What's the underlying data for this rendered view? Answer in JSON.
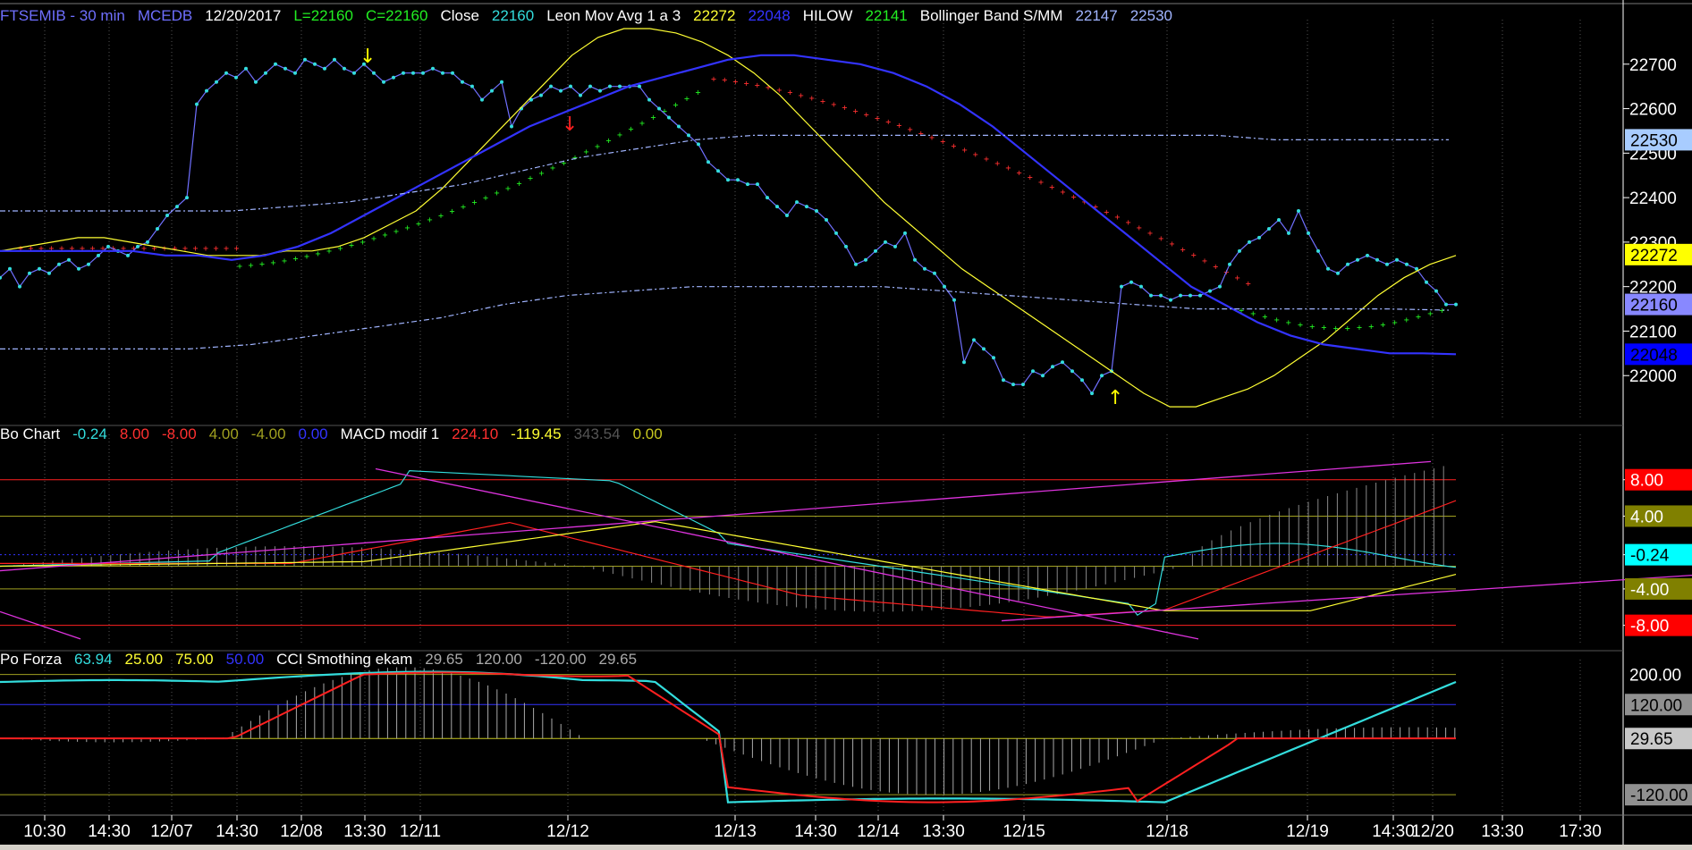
{
  "headers": {
    "price": [
      {
        "text": "FTSEMIB - 30 min",
        "color": "#6f6fff"
      },
      {
        "text": "MCEDB",
        "color": "#6f6fff"
      },
      {
        "text": "12/20/2017",
        "color": "#ffffff"
      },
      {
        "text": "L=22160",
        "color": "#22ee22"
      },
      {
        "text": "C=22160",
        "color": "#22ee22"
      },
      {
        "text": "Close",
        "color": "#ffffff"
      },
      {
        "text": "22160",
        "color": "#33dddd"
      },
      {
        "text": "Leon Mov Avg 1 a 3",
        "color": "#ffffff"
      },
      {
        "text": "22272",
        "color": "#ffff33"
      },
      {
        "text": "22048",
        "color": "#3333ff"
      },
      {
        "text": "HILOW",
        "color": "#ffffff"
      },
      {
        "text": "22141",
        "color": "#22ee22"
      },
      {
        "text": "Bollinger Band S/MM",
        "color": "#ffffff"
      },
      {
        "text": "22147",
        "color": "#a0b4ff"
      },
      {
        "text": "22530",
        "color": "#a0b4ff"
      }
    ],
    "macd": [
      {
        "text": "Bo Chart",
        "color": "#ffffff"
      },
      {
        "text": "-0.24",
        "color": "#33dddd"
      },
      {
        "text": "8.00",
        "color": "#ff3030"
      },
      {
        "text": "-8.00",
        "color": "#ff3030"
      },
      {
        "text": "4.00",
        "color": "#a0a020"
      },
      {
        "text": "-4.00",
        "color": "#a0a020"
      },
      {
        "text": "0.00",
        "color": "#3333ff"
      },
      {
        "text": "MACD modif 1",
        "color": "#ffffff"
      },
      {
        "text": "224.10",
        "color": "#ff3030"
      },
      {
        "text": "-119.45",
        "color": "#ffff33"
      },
      {
        "text": "343.54",
        "color": "#555555"
      },
      {
        "text": "0.00",
        "color": "#c8c820"
      }
    ],
    "cci": [
      {
        "text": "Po Forza",
        "color": "#ffffff"
      },
      {
        "text": "63.94",
        "color": "#33dddd"
      },
      {
        "text": "25.00",
        "color": "#ffff33"
      },
      {
        "text": "75.00",
        "color": "#ffff33"
      },
      {
        "text": "50.00",
        "color": "#3333ff"
      },
      {
        "text": "CCI Smothing ekam",
        "color": "#ffffff"
      },
      {
        "text": "29.65",
        "color": "#aaaaaa"
      },
      {
        "text": "120.00",
        "color": "#aaaaaa"
      },
      {
        "text": "-120.00",
        "color": "#aaaaaa"
      },
      {
        "text": "29.65",
        "color": "#aaaaaa"
      }
    ]
  },
  "chart_data": [
    {
      "type": "line",
      "title": "FTSEMIB - 30 min",
      "ylim": [
        21900,
        22800
      ],
      "y_ticks": [
        "22700",
        "22600",
        "22500",
        "22400",
        "22300",
        "22200",
        "22100",
        "22000"
      ],
      "tags": [
        {
          "label": "22530",
          "bg": "#a8ccff",
          "fg": "#000000"
        },
        {
          "label": "22272",
          "bg": "#ffff00",
          "fg": "#000000"
        },
        {
          "label": "22160",
          "bg": "#8888ff",
          "fg": "#000000"
        },
        {
          "label": "22048",
          "bg": "#0000ff",
          "fg": "#000000"
        }
      ],
      "series": [
        {
          "name": "Close",
          "color": "#33dddd",
          "values": [
            22220,
            22240,
            22200,
            22230,
            22240,
            22230,
            22250,
            22260,
            22240,
            22250,
            22270,
            22290,
            22280,
            22270,
            22290,
            22300,
            22330,
            22360,
            22380,
            22400,
            22610,
            22640,
            22660,
            22680,
            22670,
            22690,
            22660,
            22680,
            22700,
            22690,
            22680,
            22710,
            22700,
            22690,
            22710,
            22690,
            22680,
            22700,
            22680,
            22660,
            22670,
            22680,
            22680,
            22680,
            22690,
            22680,
            22680,
            22660,
            22650,
            22620,
            22640,
            22660,
            22560,
            22600,
            22620,
            22630,
            22650,
            22640,
            22650,
            22630,
            22650,
            22640,
            22650,
            22650,
            22650,
            22650,
            22620,
            22600,
            22580,
            22560,
            22540,
            22520,
            22480,
            22460,
            22440,
            22440,
            22430,
            22430,
            22400,
            22380,
            22360,
            22390,
            22380,
            22370,
            22350,
            22320,
            22290,
            22250,
            22260,
            22280,
            22300,
            22290,
            22320,
            22260,
            22240,
            22230,
            22200,
            22170,
            22030,
            22080,
            22060,
            22040,
            21990,
            21980,
            21980,
            22010,
            22000,
            22020,
            22030,
            22010,
            21990,
            21960,
            22000,
            22010,
            22200,
            22210,
            22200,
            22180,
            22180,
            22170,
            22180,
            22180,
            22180,
            22190,
            22200,
            22250,
            22280,
            22300,
            22310,
            22330,
            22350,
            22320,
            22370,
            22320,
            22280,
            22240,
            22230,
            22250,
            22260,
            22270,
            22260,
            22250,
            22260,
            22250,
            22240,
            22210,
            22190,
            22160,
            22160
          ]
        },
        {
          "name": "Leon Mov Avg yellow",
          "color": "#ffff33",
          "values": [
            22280,
            22290,
            22300,
            22310,
            22310,
            22300,
            22290,
            22280,
            22270,
            22270,
            22270,
            22280,
            22280,
            22290,
            22310,
            22340,
            22370,
            22420,
            22480,
            22540,
            22600,
            22660,
            22720,
            22760,
            22780,
            22780,
            22770,
            22750,
            22720,
            22680,
            22630,
            22570,
            22510,
            22450,
            22390,
            22340,
            22290,
            22240,
            22200,
            22160,
            22120,
            22080,
            22040,
            22000,
            21960,
            21930,
            21930,
            21950,
            21970,
            22000,
            22040,
            22080,
            22130,
            22180,
            22220,
            22250,
            22270
          ]
        },
        {
          "name": "Leon Mov Avg blue",
          "color": "#3333ff",
          "values": [
            22280,
            22280,
            22280,
            22280,
            22280,
            22270,
            22270,
            22260,
            22270,
            22290,
            22320,
            22360,
            22400,
            22440,
            22480,
            22520,
            22560,
            22590,
            22620,
            22650,
            22670,
            22690,
            22710,
            22720,
            22720,
            22710,
            22700,
            22680,
            22650,
            22610,
            22560,
            22500,
            22440,
            22380,
            22320,
            22260,
            22200,
            22160,
            22120,
            22090,
            22070,
            22060,
            22050,
            22050,
            22048
          ]
        },
        {
          "name": "Bollinger upper",
          "color": "#a0b4ff",
          "values": [
            22370,
            22370,
            22370,
            22370,
            22370,
            22380,
            22390,
            22410,
            22430,
            22460,
            22490,
            22510,
            22530,
            22540,
            22540,
            22540,
            22540,
            22540,
            22540,
            22540,
            22540,
            22540,
            22530,
            22530,
            22530,
            22530
          ]
        },
        {
          "name": "Bollinger lower",
          "color": "#a0b4ff",
          "values": [
            22060,
            22060,
            22060,
            22060,
            22070,
            22090,
            22110,
            22130,
            22160,
            22180,
            22190,
            22200,
            22200,
            22200,
            22200,
            22190,
            22180,
            22170,
            22160,
            22150,
            22150,
            22150,
            22150,
            22147
          ]
        }
      ]
    },
    {
      "type": "line",
      "title": "MACD modif 1",
      "ylim": [
        -10,
        12
      ],
      "y_ticks": [
        "8.00",
        "4.00",
        "-0.24",
        "-4.00",
        "-8.00"
      ],
      "tags": [
        {
          "label": "8.00",
          "bg": "#ff0000",
          "fg": "#ffffff"
        },
        {
          "label": "4.00",
          "bg": "#808000",
          "fg": "#ffffff"
        },
        {
          "label": "-0.24",
          "bg": "#00ffff",
          "fg": "#000000"
        },
        {
          "label": "-4.00",
          "bg": "#808000",
          "fg": "#ffffff"
        },
        {
          "label": "-8.00",
          "bg": "#ff0000",
          "fg": "#ffffff"
        }
      ]
    },
    {
      "type": "line",
      "title": "CCI Smothing ekam",
      "ylim": [
        -160,
        230
      ],
      "y_ticks": [
        "200.00",
        "120.00",
        "29.65",
        "-120.00"
      ],
      "tags": [
        {
          "label": "120.00",
          "bg": "#909090",
          "fg": "#000000"
        },
        {
          "label": "29.65",
          "bg": "#c8c8c8",
          "fg": "#000000"
        },
        {
          "label": "-120.00",
          "bg": "#909090",
          "fg": "#000000"
        }
      ]
    }
  ],
  "x_labels": [
    "10:30",
    "14:30",
    "12/07",
    "14:30",
    "12/08",
    "13:30",
    "12/11",
    "12/12",
    "12/13",
    "14:30",
    "12/14",
    "13:30",
    "12/15",
    "12/18",
    "12/19",
    "14:30",
    "12/20",
    "13:30",
    "17:30"
  ]
}
